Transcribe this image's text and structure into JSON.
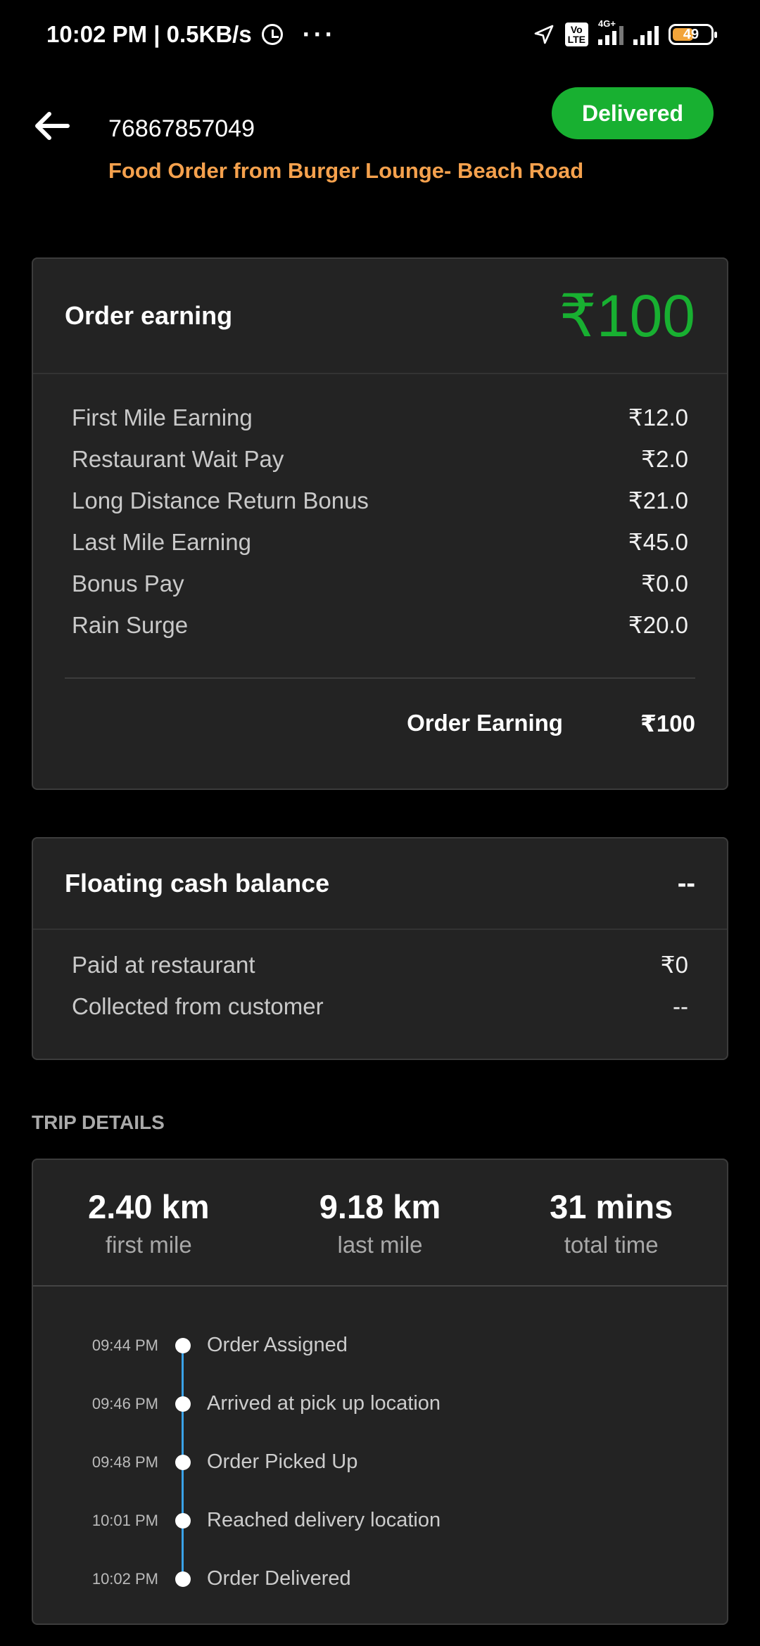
{
  "status_bar": {
    "time_speed": "10:02 PM | 0.5KB/s",
    "more": "···",
    "network": "4G+",
    "volte": "Vo\nLTE",
    "battery": "49"
  },
  "header": {
    "order_id": "76867857049",
    "subtitle": "Food Order from Burger Lounge- Beach Road",
    "status": "Delivered"
  },
  "earning": {
    "title": "Order earning",
    "amount": "₹100",
    "items": [
      {
        "label": "First Mile Earning",
        "value": "₹12.0"
      },
      {
        "label": "Restaurant Wait Pay",
        "value": "₹2.0"
      },
      {
        "label": "Long Distance Return Bonus",
        "value": "₹21.0"
      },
      {
        "label": "Last Mile Earning",
        "value": "₹45.0"
      },
      {
        "label": "Bonus Pay",
        "value": "₹0.0"
      },
      {
        "label": "Rain Surge",
        "value": "₹20.0"
      }
    ],
    "total_label": "Order Earning",
    "total_value": "₹100"
  },
  "cash": {
    "title": "Floating cash balance",
    "value": "--",
    "items": [
      {
        "label": "Paid at restaurant",
        "value": "₹0"
      },
      {
        "label": "Collected from customer",
        "value": "--"
      }
    ]
  },
  "trip": {
    "section_label": "TRIP DETAILS",
    "stats": [
      {
        "value": "2.40 km",
        "caption": "first mile"
      },
      {
        "value": "9.18 km",
        "caption": "last mile"
      },
      {
        "value": "31 mins",
        "caption": "total time"
      }
    ],
    "timeline": [
      {
        "time": "09:44 PM",
        "event": "Order Assigned"
      },
      {
        "time": "09:46 PM",
        "event": "Arrived at pick up location"
      },
      {
        "time": "09:48 PM",
        "event": "Order Picked Up"
      },
      {
        "time": "10:01 PM",
        "event": "Reached delivery location"
      },
      {
        "time": "10:02 PM",
        "event": "Order Delivered"
      }
    ]
  },
  "colors": {
    "accent_green": "#18b031",
    "accent_orange": "#f5a14d",
    "timeline_blue": "#3aa2e8"
  }
}
